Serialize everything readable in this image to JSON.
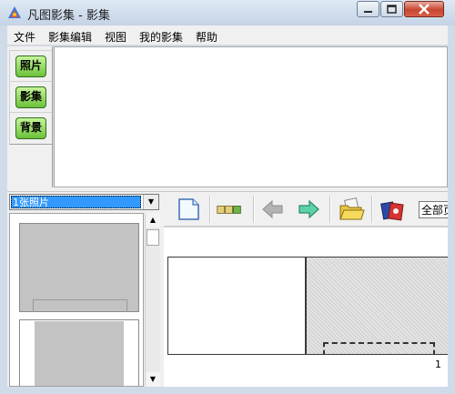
{
  "window": {
    "title": "凡图影集 - 影集"
  },
  "menu": {
    "items": [
      "文件",
      "影集编辑",
      "视图",
      "我的影集",
      "帮助"
    ]
  },
  "side_tabs": {
    "items": [
      "照片",
      "影集",
      "背景"
    ]
  },
  "photo_selector": {
    "value": "1张照片"
  },
  "toolbar": {
    "icons": [
      "new-page-icon",
      "page-layout-icon",
      "back-arrow-icon",
      "forward-arrow-icon",
      "open-folder-icon",
      "album-books-icon"
    ],
    "select_label": "全部页"
  },
  "page_view": {
    "page_number": "1"
  },
  "colors": {
    "tab_button_green": "#7ccf45",
    "selection_blue": "#3399ff",
    "close_button_red": "#c8442f"
  }
}
